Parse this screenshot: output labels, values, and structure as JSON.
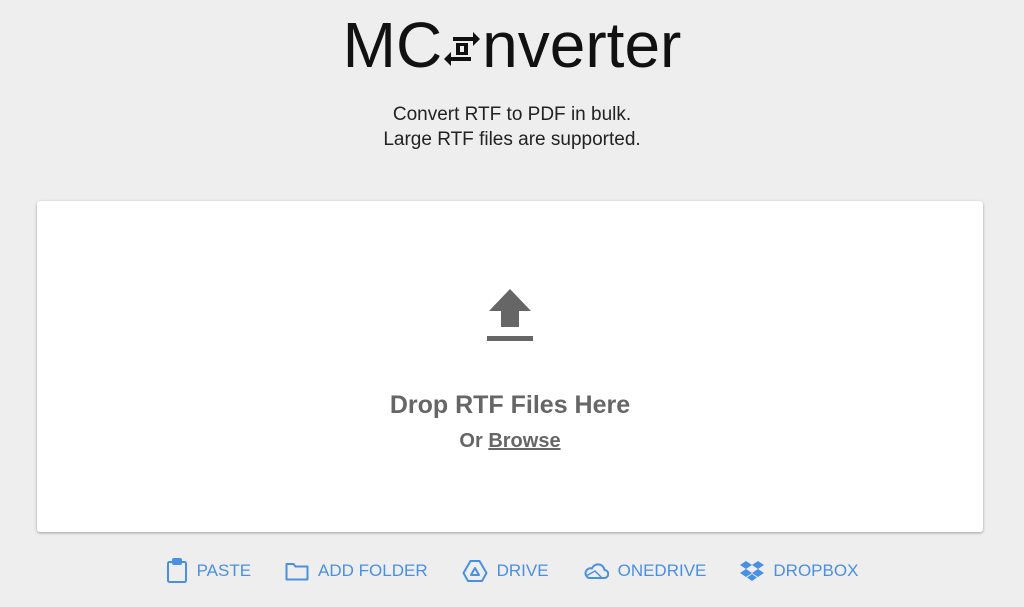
{
  "logo": {
    "before": "MC",
    "after": "nverter"
  },
  "tagline": {
    "line1": "Convert RTF to PDF in bulk.",
    "line2": "Large RTF files are supported."
  },
  "dropzone": {
    "title": "Drop RTF Files Here",
    "or_label": "Or",
    "browse_label": "Browse"
  },
  "sources": {
    "paste": "PASTE",
    "add_folder": "ADD FOLDER",
    "drive": "DRIVE",
    "onedrive": "ONEDRIVE",
    "dropbox": "DROPBOX"
  },
  "colors": {
    "page_bg": "#eeeeee",
    "card_bg": "#ffffff",
    "accent": "#4a90e2",
    "muted": "#666666"
  },
  "icons": [
    "convert-arrows-icon",
    "upload-icon",
    "clipboard-icon",
    "folder-icon",
    "drive-icon",
    "cloud-icon",
    "dropbox-icon"
  ]
}
